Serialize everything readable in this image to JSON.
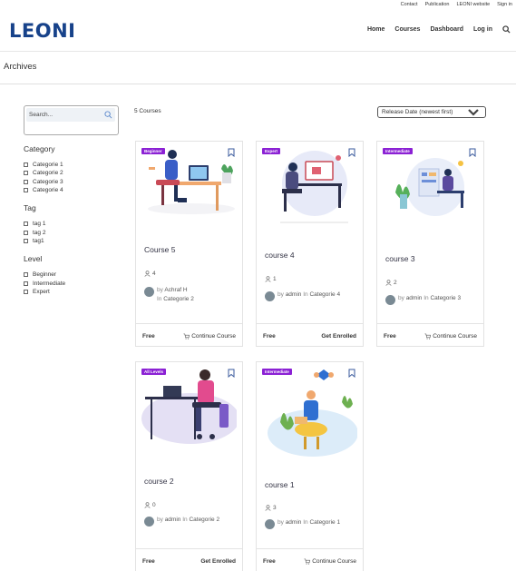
{
  "topbar": [
    "Contact",
    "Publication",
    "LEONI website",
    "Sign in"
  ],
  "logo": "LEONI",
  "nav": [
    "Home",
    "Courses",
    "Dashboard",
    "Log in"
  ],
  "page_title": "Archives",
  "search_placeholder": "Search...",
  "filters": {
    "category": {
      "title": "Category",
      "items": [
        "Categorie 1",
        "Categorie 2",
        "Categorie 3",
        "Categorie 4"
      ]
    },
    "tag": {
      "title": "Tag",
      "items": [
        "tag 1",
        "tag 2",
        "tag1"
      ]
    },
    "level": {
      "title": "Level",
      "items": [
        "Beginner",
        "Intermediate",
        "Expert"
      ]
    }
  },
  "course_count": "5 Courses",
  "sort_label": "Release Date (newest first)",
  "colors": {
    "brand": "#17428a",
    "badge": "#8b21d4"
  },
  "courses": [
    {
      "title": "Course 5",
      "badge": "Beginner",
      "students": "4",
      "by": "by",
      "author": "Achraf H",
      "in": "In",
      "category": "Categorie 2",
      "price": "Free",
      "action": "Continue Course"
    },
    {
      "title": "course 4",
      "badge": "Expert",
      "students": "1",
      "by": "by",
      "author": "admin",
      "in": "In",
      "category": "Categorie 4",
      "price": "Free",
      "action": "Get Enrolled"
    },
    {
      "title": "course 3",
      "badge": "Intermediate",
      "students": "2",
      "by": "by",
      "author": "admin",
      "in": "In",
      "category": "Categorie 3",
      "price": "Free",
      "action": "Continue Course"
    },
    {
      "title": "course 2",
      "badge": "All Levels",
      "students": "0",
      "by": "by",
      "author": "admin",
      "in": "In",
      "category": "Categorie 2",
      "price": "Free",
      "action": "Get Enrolled"
    },
    {
      "title": "course 1",
      "badge": "Intermediate",
      "students": "3",
      "by": "by",
      "author": "admin",
      "in": "In",
      "category": "Categorie 1",
      "price": "Free",
      "action": "Continue Course"
    }
  ]
}
